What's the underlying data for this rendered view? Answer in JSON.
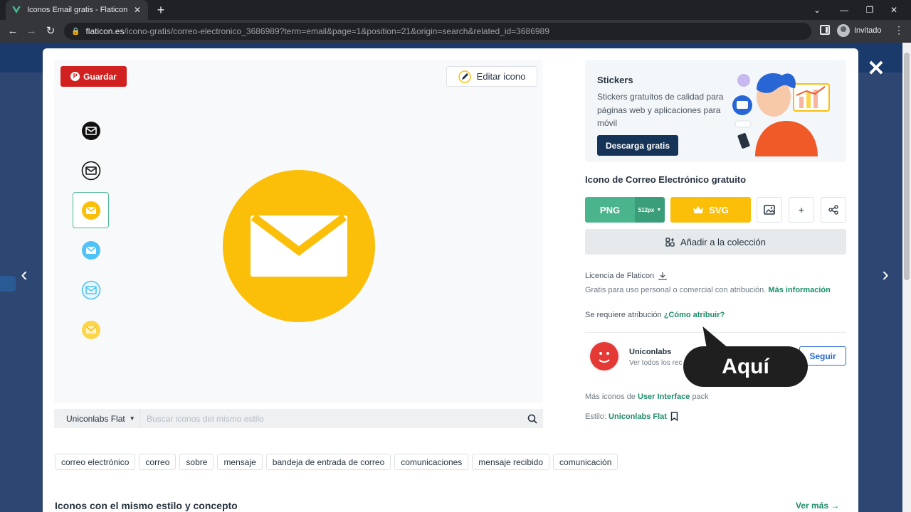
{
  "browser": {
    "tab_title": "Iconos Email gratis - Flaticon",
    "url_host": "flaticon.es",
    "url_path": "/icono-gratis/correo-electronico_3686989?term=email&page=1&position=21&origin=search&related_id=3686989",
    "profile_label": "Invitado"
  },
  "preview": {
    "save_label": "Guardar",
    "edit_label": "Editar icono",
    "style_select": "Uniconlabs Flat",
    "style_search_placeholder": "Buscar iconos del mismo estilo",
    "variants": [
      {
        "name": "black-filled",
        "color": "#111111"
      },
      {
        "name": "black-outline",
        "color": "#111111"
      },
      {
        "name": "yellow-filled",
        "color": "#fbbf0a"
      },
      {
        "name": "blue-filled",
        "color": "#4fc3f7"
      },
      {
        "name": "blue-outline",
        "color": "#4fc3f7"
      },
      {
        "name": "yellow-gradient",
        "color": "#fbd54a"
      }
    ],
    "main_icon_color": "#fbbf0a"
  },
  "tags": [
    "correo electrónico",
    "correo",
    "sobre",
    "mensaje",
    "bandeja de entrada de correo",
    "comunicaciones",
    "mensaje recibido",
    "comunicación"
  ],
  "related": {
    "title": "Iconos con el mismo estilo y concepto",
    "more_label": "Ver más"
  },
  "stickers": {
    "title": "Stickers",
    "description": "Stickers gratuitos de calidad para páginas web y aplicaciones para móvil",
    "button": "Descarga gratis"
  },
  "detail": {
    "title": "Icono de Correo Electrónico gratuito",
    "png_label": "PNG",
    "png_size": "512px",
    "svg_label": "SVG",
    "add_collection": "Añadir a la colección",
    "license_label": "Licencia de Flaticon",
    "license_text": "Gratis para uso personal o comercial con atribución.",
    "license_more": "Más información",
    "attribution_text": "Se requiere atribución",
    "attribution_link": "¿Cómo atribuir?",
    "author_name": "Uniconlabs",
    "author_sub": "Ver todos los recursos",
    "follow_label": "Seguir",
    "pack_prefix": "Más iconos de",
    "pack_name": "User Interface",
    "pack_suffix": "pack",
    "style_prefix": "Estilo:",
    "style_name": "Uniconlabs Flat"
  },
  "callout": {
    "text": "Aquí"
  },
  "colors": {
    "green": "#4ab58d",
    "yellow": "#fbbf0a",
    "navy": "#163457",
    "pinterest": "#d02020",
    "link": "#1c8c6b"
  }
}
